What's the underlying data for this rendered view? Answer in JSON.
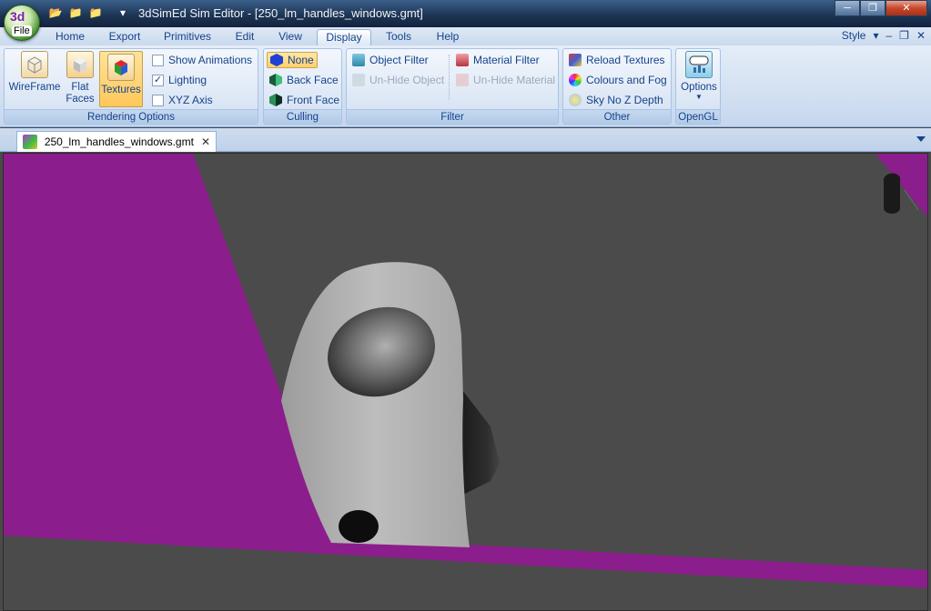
{
  "window": {
    "title": "3dSimEd Sim Editor - [250_lm_handles_windows.gmt]",
    "controls": [
      "─",
      "❐",
      "✕"
    ]
  },
  "file_button": {
    "label": "File",
    "logo": "3d"
  },
  "quick_access": {
    "icons": [
      "folder-open-icon",
      "folder-green-icon",
      "folder-icon",
      "dropdown-arrow-icon"
    ]
  },
  "menu": {
    "tabs": [
      "Home",
      "Export",
      "Primitives",
      "Edit",
      "View",
      "Display",
      "Tools",
      "Help"
    ],
    "active": "Display",
    "style_label": "Style"
  },
  "ribbon": {
    "rendering": {
      "label": "Rendering Options",
      "buttons": [
        {
          "label": "WireFrame",
          "icon": "wireframe-cube-icon"
        },
        {
          "label": "Flat",
          "label2": "Faces",
          "icon": "flat-cube-icon"
        },
        {
          "label": "Textures",
          "icon": "textured-cube-icon",
          "active": true
        }
      ],
      "checks": [
        {
          "label": "Show Animations",
          "checked": false
        },
        {
          "label": "Lighting",
          "checked": true
        },
        {
          "label": "XYZ Axis",
          "checked": false
        }
      ]
    },
    "culling": {
      "label": "Culling",
      "items": [
        {
          "label": "None",
          "selected": true
        },
        {
          "label": "Back Face",
          "selected": false
        },
        {
          "label": "Front Face",
          "selected": false
        }
      ]
    },
    "filter": {
      "label": "Filter",
      "items": [
        {
          "label": "Object Filter",
          "enabled": true
        },
        {
          "label": "Un-Hide Object",
          "enabled": false
        },
        {
          "label": "Material Filter",
          "enabled": true
        },
        {
          "label": "Un-Hide Material",
          "enabled": false
        }
      ]
    },
    "other": {
      "label": "Other",
      "items": [
        {
          "label": "Reload Textures"
        },
        {
          "label": "Colours and Fog"
        },
        {
          "label": "Sky No Z Depth"
        }
      ]
    },
    "opengl": {
      "label": "OpenGL",
      "button": "Options"
    }
  },
  "document": {
    "tab": "250_lm_handles_windows.gmt"
  },
  "colors": {
    "accent": "#15428b",
    "magenta": "#8c1d8c",
    "viewport": "#4b4b4b"
  }
}
